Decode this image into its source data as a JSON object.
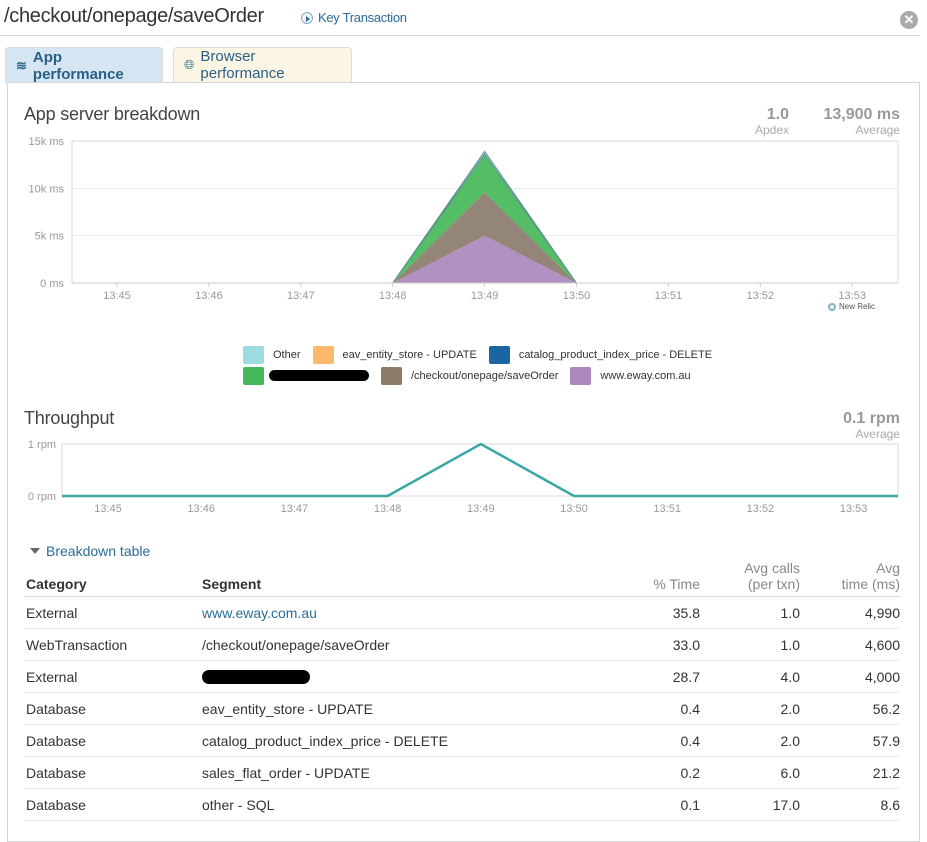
{
  "header": {
    "title": "/checkout/onepage/saveOrder",
    "key_transaction_label": "Key Transaction",
    "close_icon": "close-circle-icon"
  },
  "tabs": [
    {
      "label": "App performance",
      "icon": "stack-icon",
      "active": true
    },
    {
      "label": "Browser performance",
      "icon": "globe-icon",
      "active": false
    }
  ],
  "app_breakdown": {
    "title": "App server breakdown",
    "apdex_value": "1.0",
    "apdex_label": "Apdex",
    "average_value": "13,900 ms",
    "average_label": "Average",
    "branding": "New Relic"
  },
  "throughput": {
    "title": "Throughput",
    "average_value": "0.1 rpm",
    "average_label": "Average"
  },
  "legend": [
    {
      "label": "Other",
      "color": "#9cdcde"
    },
    {
      "label": "eav_entity_store - UPDATE",
      "color": "#fdb96b"
    },
    {
      "label": "catalog_product_index_price - DELETE",
      "color": "#1a66a0"
    },
    {
      "label": "",
      "color": "#45b85a",
      "redacted": true
    },
    {
      "label": "/checkout/onepage/saveOrder",
      "color": "#8a7b6b"
    },
    {
      "label": "www.eway.com.au",
      "color": "#ab88bd"
    }
  ],
  "chart_data": [
    {
      "type": "area",
      "title": "App server breakdown",
      "xlabel": "",
      "ylabel": "",
      "x": [
        "13:44:30",
        "13:45",
        "13:46",
        "13:47",
        "13:47:30",
        "13:48:30",
        "13:49:30",
        "13:50",
        "13:51",
        "13:52",
        "13:53",
        "13:53:30"
      ],
      "x_ticks": [
        "13:45",
        "13:46",
        "13:47",
        "13:48",
        "13:49",
        "13:50",
        "13:51",
        "13:52",
        "13:53"
      ],
      "y_ticks": [
        "0 ms",
        "5k ms",
        "10k ms",
        "15k ms"
      ],
      "ylim": [
        0,
        15000
      ],
      "stacked": true,
      "grid": true,
      "series": [
        {
          "name": "www.eway.com.au",
          "color": "#ab88bd",
          "points": [
            [
              3.0,
              0
            ],
            [
              4.0,
              4990
            ],
            [
              5.0,
              0
            ]
          ]
        },
        {
          "name": "/checkout/onepage/saveOrder",
          "color": "#8a7b6b",
          "points": [
            [
              3.0,
              0
            ],
            [
              4.0,
              4600
            ],
            [
              5.0,
              0
            ]
          ]
        },
        {
          "name": "(redacted external)",
          "color": "#45b85a",
          "points": [
            [
              3.0,
              0
            ],
            [
              4.0,
              4000
            ],
            [
              5.0,
              0
            ]
          ]
        },
        {
          "name": "Other",
          "color": "#9cdcde",
          "points": [
            [
              3.0,
              0
            ],
            [
              4.0,
              310
            ],
            [
              5.0,
              0
            ]
          ]
        }
      ]
    },
    {
      "type": "line",
      "title": "Throughput",
      "x_ticks": [
        "13:45",
        "13:46",
        "13:47",
        "13:48",
        "13:49",
        "13:50",
        "13:51",
        "13:52",
        "13:53"
      ],
      "y_ticks": [
        "0 rpm",
        "1 rpm"
      ],
      "ylim": [
        0,
        1
      ],
      "grid": false,
      "series": [
        {
          "name": "Throughput",
          "color": "#3aa7a3",
          "points": [
            [
              -0.5,
              0
            ],
            [
              0.5,
              0
            ],
            [
              1.5,
              0
            ],
            [
              2.5,
              0
            ],
            [
              3.0,
              0
            ],
            [
              4.0,
              1
            ],
            [
              5.0,
              0
            ],
            [
              5.5,
              0
            ],
            [
              6.5,
              0
            ],
            [
              7.5,
              0
            ],
            [
              8.5,
              0
            ],
            [
              9.0,
              0
            ]
          ]
        }
      ]
    }
  ],
  "breakdown": {
    "toggle_label": "Breakdown table",
    "columns": {
      "category": "Category",
      "segment": "Segment",
      "pct_time": "% Time",
      "avg_calls_1": "Avg calls",
      "avg_calls_2": "(per txn)",
      "avg_time_1": "Avg",
      "avg_time_2": "time (ms)"
    },
    "rows": [
      {
        "category": "External",
        "segment": "www.eway.com.au",
        "link": true,
        "pct": "35.8",
        "calls": "1.0",
        "time": "4,990"
      },
      {
        "category": "WebTransaction",
        "segment": "/checkout/onepage/saveOrder",
        "link": false,
        "pct": "33.0",
        "calls": "1.0",
        "time": "4,600"
      },
      {
        "category": "External",
        "segment": "",
        "link": true,
        "redacted": true,
        "pct": "28.7",
        "calls": "4.0",
        "time": "4,000"
      },
      {
        "category": "Database",
        "segment": "eav_entity_store - UPDATE",
        "link": false,
        "pct": "0.4",
        "calls": "2.0",
        "time": "56.2"
      },
      {
        "category": "Database",
        "segment": "catalog_product_index_price - DELETE",
        "link": false,
        "pct": "0.4",
        "calls": "2.0",
        "time": "57.9"
      },
      {
        "category": "Database",
        "segment": "sales_flat_order - UPDATE",
        "link": false,
        "pct": "0.2",
        "calls": "6.0",
        "time": "21.2"
      },
      {
        "category": "Database",
        "segment": "other - SQL",
        "link": false,
        "pct": "0.1",
        "calls": "17.0",
        "time": "8.6"
      }
    ]
  }
}
